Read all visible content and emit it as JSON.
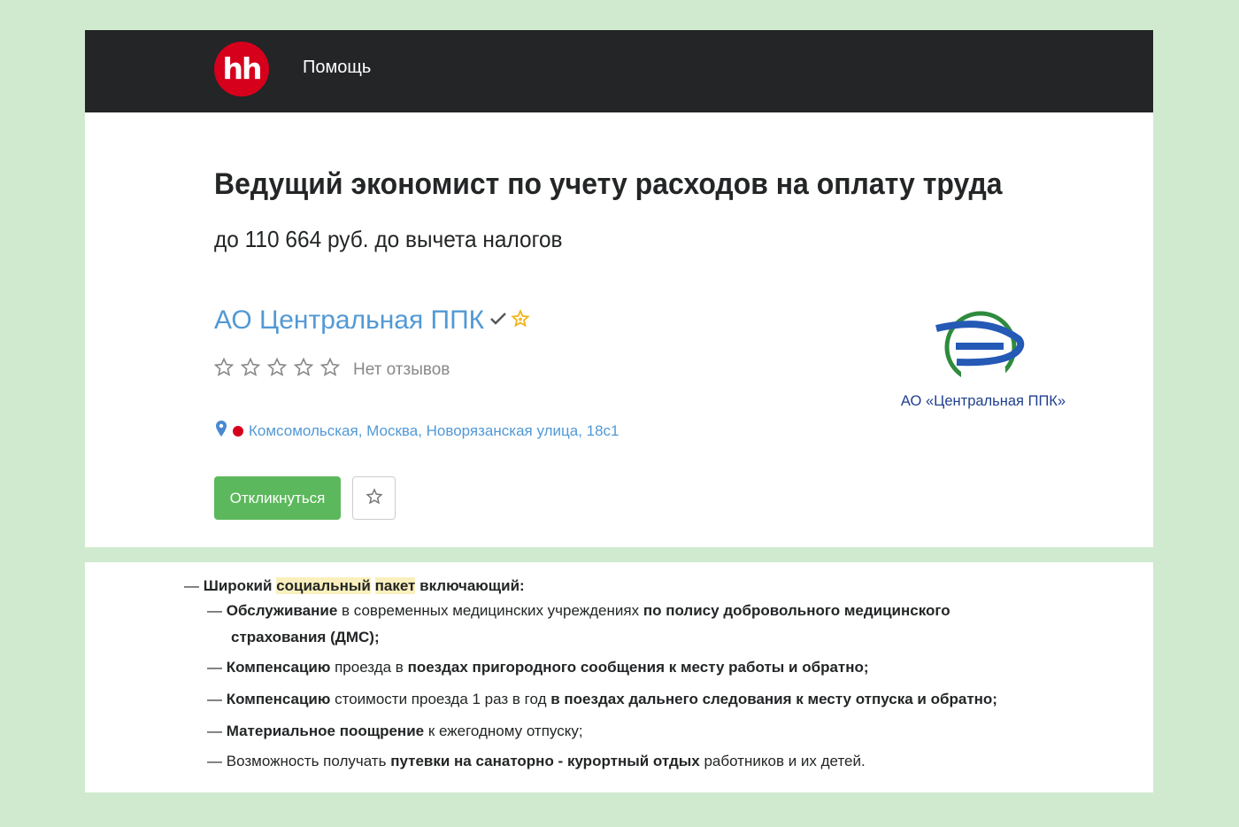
{
  "header": {
    "logo_text": "hh",
    "help_label": "Помощь"
  },
  "vacancy": {
    "title": "Ведущий экономист по учету расходов на оплату труда",
    "salary": "до 110 664 руб. до вычета налогов"
  },
  "company": {
    "name": "АО Центральная ППК",
    "reviews_label": "Нет отзывов",
    "rating_stars": 0,
    "address": "Комсомольская, Москва, Новорязанская улица, 18с1",
    "logo_caption": "АО «Центральная ППК»"
  },
  "actions": {
    "respond_label": "Откликнуться"
  },
  "description": {
    "lines": [
      {
        "dash": "— ",
        "parts": [
          {
            "t": "Широкий ",
            "b": true
          },
          {
            "t": "социальный",
            "b": true,
            "hl": true
          },
          {
            "t": " ",
            "b": true
          },
          {
            "t": "пакет",
            "b": true,
            "hl": true
          },
          {
            "t": " включающий:",
            "b": true
          }
        ]
      },
      {
        "dash": "— ",
        "parts": [
          {
            "t": "Обслуживание",
            "b": true
          },
          {
            "t": " в современных медицинских учреждениях "
          },
          {
            "t": "по полису добровольного медицинского",
            "b": true
          }
        ]
      },
      {
        "dash": "",
        "parts": [
          {
            "t": "страхования (ДМС);",
            "b": true
          }
        ]
      },
      {
        "dash": "— ",
        "parts": [
          {
            "t": "Компенсацию",
            "b": true
          },
          {
            "t": " проезда в "
          },
          {
            "t": "поездах пригородного сообщения к месту работы и обратно;",
            "b": true
          }
        ]
      },
      {
        "dash": "— ",
        "parts": [
          {
            "t": "Компенсацию",
            "b": true
          },
          {
            "t": " стоимости проезда 1 раз в год "
          },
          {
            "t": "в поездах дальнего следования к месту отпуска и обратно;",
            "b": true
          }
        ]
      },
      {
        "dash": "— ",
        "parts": [
          {
            "t": "Материальное поощрение",
            "b": true
          },
          {
            "t": " к ежегодному отпуску;"
          }
        ]
      },
      {
        "dash": "— ",
        "parts": [
          {
            "t": "Возможность получать "
          },
          {
            "t": "путевки на санаторно - курортный отдых",
            "b": true
          },
          {
            "t": " работников и их детей."
          }
        ]
      }
    ]
  },
  "colors": {
    "brand_red": "#d6001c",
    "link_blue": "#5199d6",
    "respond_green": "#5cb85c",
    "highlight": "#faf0bd"
  }
}
